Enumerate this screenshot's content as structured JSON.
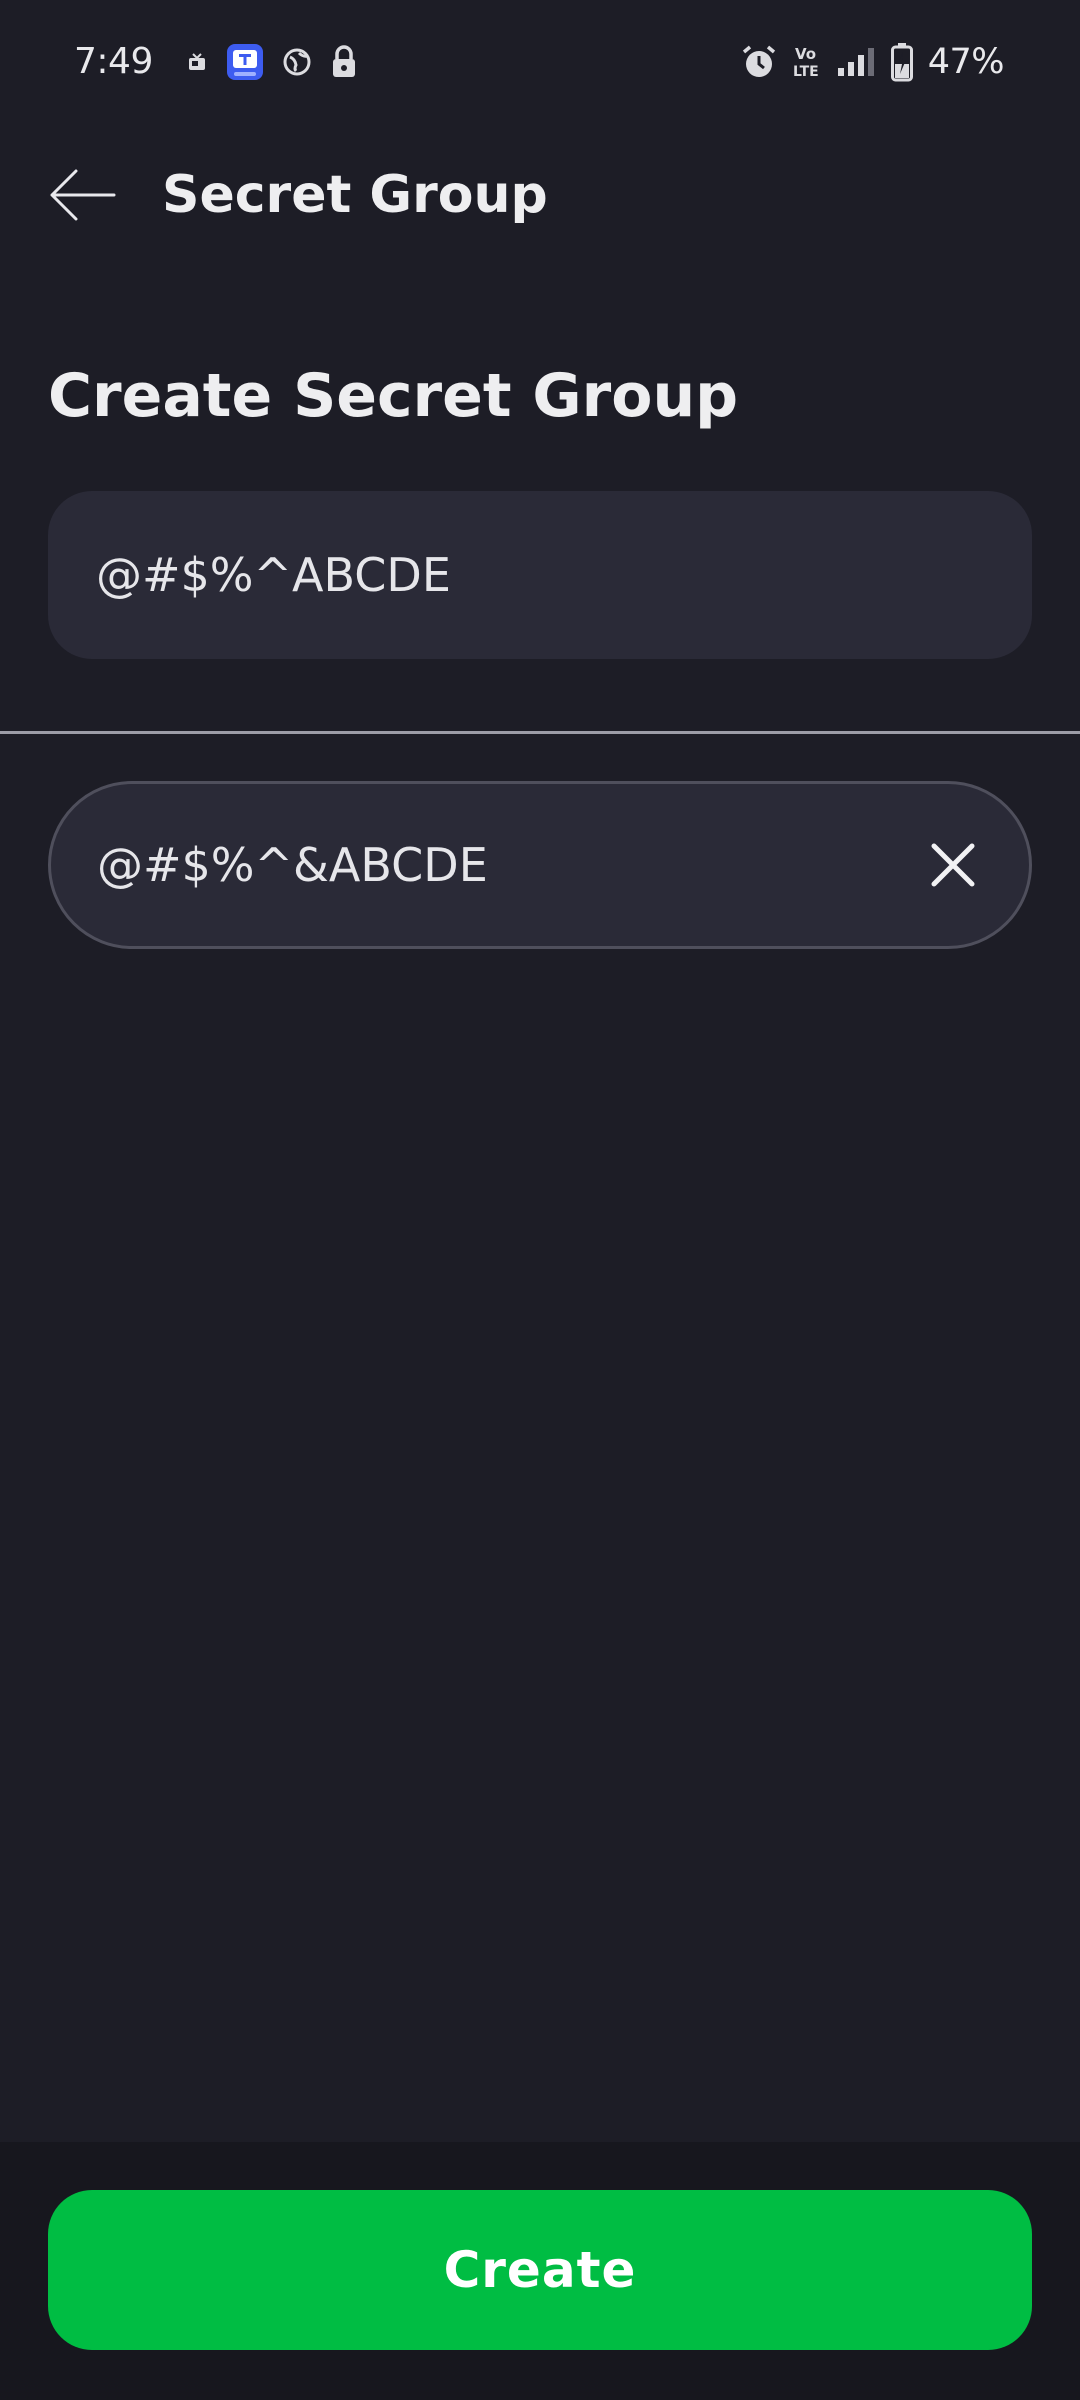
{
  "status_bar": {
    "time": "7:49",
    "battery_percent": "47%",
    "icons_left": [
      "video-notification-icon",
      "app-notification-icon",
      "vpn-globe-icon",
      "lock-icon"
    ],
    "icons_right": [
      "alarm-icon",
      "volte-icon",
      "signal-icon",
      "battery-charging-icon"
    ]
  },
  "app_bar": {
    "title": "Secret Group",
    "back_icon": "arrow-left-icon"
  },
  "main": {
    "heading": "Create Secret Group",
    "display_value": "@#$%^ABCDE",
    "input_value": "@#$%^&ABCDE",
    "clear_icon": "close-icon"
  },
  "bottom": {
    "create_label": "Create"
  },
  "colors": {
    "background": "#1d1d26",
    "field": "#2a2a37",
    "accent": "#00bd43",
    "bottom_bar": "#17171e"
  }
}
